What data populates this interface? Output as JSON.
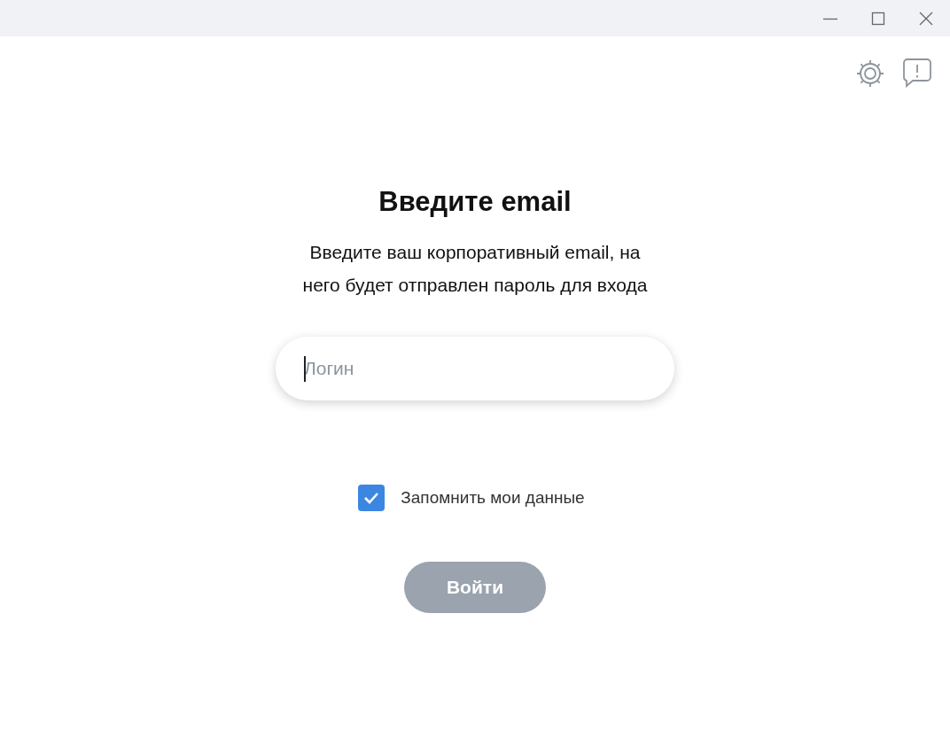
{
  "heading": "Введите email",
  "description_lines": [
    "Введите ваш корпоративный email, на",
    "него будет отправлен пароль для входа"
  ],
  "login_field": {
    "placeholder": "Логин",
    "focused": true
  },
  "remember": {
    "label": "Запомнить мои данные",
    "checked": true
  },
  "submit": {
    "label": "Войти",
    "disabled": true
  }
}
